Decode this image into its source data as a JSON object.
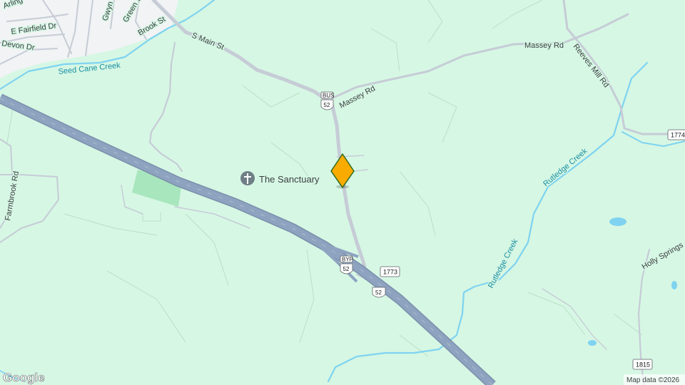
{
  "colors": {
    "land": "#d6f7e4",
    "urban": "#f1f3f4",
    "road": "#c6ccd6",
    "highway": "#8ea3c0",
    "highway_edge": "#7b8fab",
    "water": "#7fd3f0",
    "park": "#a8e6bd",
    "marker": "#f9ab00",
    "marker_border": "#2e6b1f",
    "poi_icon": "#6f7f86"
  },
  "streets": {
    "arlington": "Arling",
    "gwyn": "Gwyn",
    "green": "Green S",
    "fairfield": "E Fairfield Dr",
    "brook": "Brook St",
    "devon": "Devon Dr",
    "s_main": "S Main St",
    "massey_rd_1": "Massey Rd",
    "massey_rd_2": "Massey Rd",
    "reeves_mill": "Reeves Mill Rd",
    "farmbrook": "Farmbrook Rd",
    "holly_springs": "Holly Springs"
  },
  "waterways": {
    "seed_cane": "Seed Cane Creek",
    "rutledge_1": "Rutledge Creek",
    "rutledge_2": "Rutledge Creek"
  },
  "poi": {
    "name": "The Sanctuary",
    "icon": "church-cross-icon"
  },
  "routes": {
    "bus_prefix": "BUS",
    "bus_number": "52",
    "byp_prefix": "BYP",
    "byp_number": "52",
    "us_52": "52",
    "sr_1773": "1773",
    "sr_1774": "1774",
    "sr_1815": "1815"
  },
  "branding": {
    "logo": "Google",
    "attribution": "Map data ©2026"
  }
}
